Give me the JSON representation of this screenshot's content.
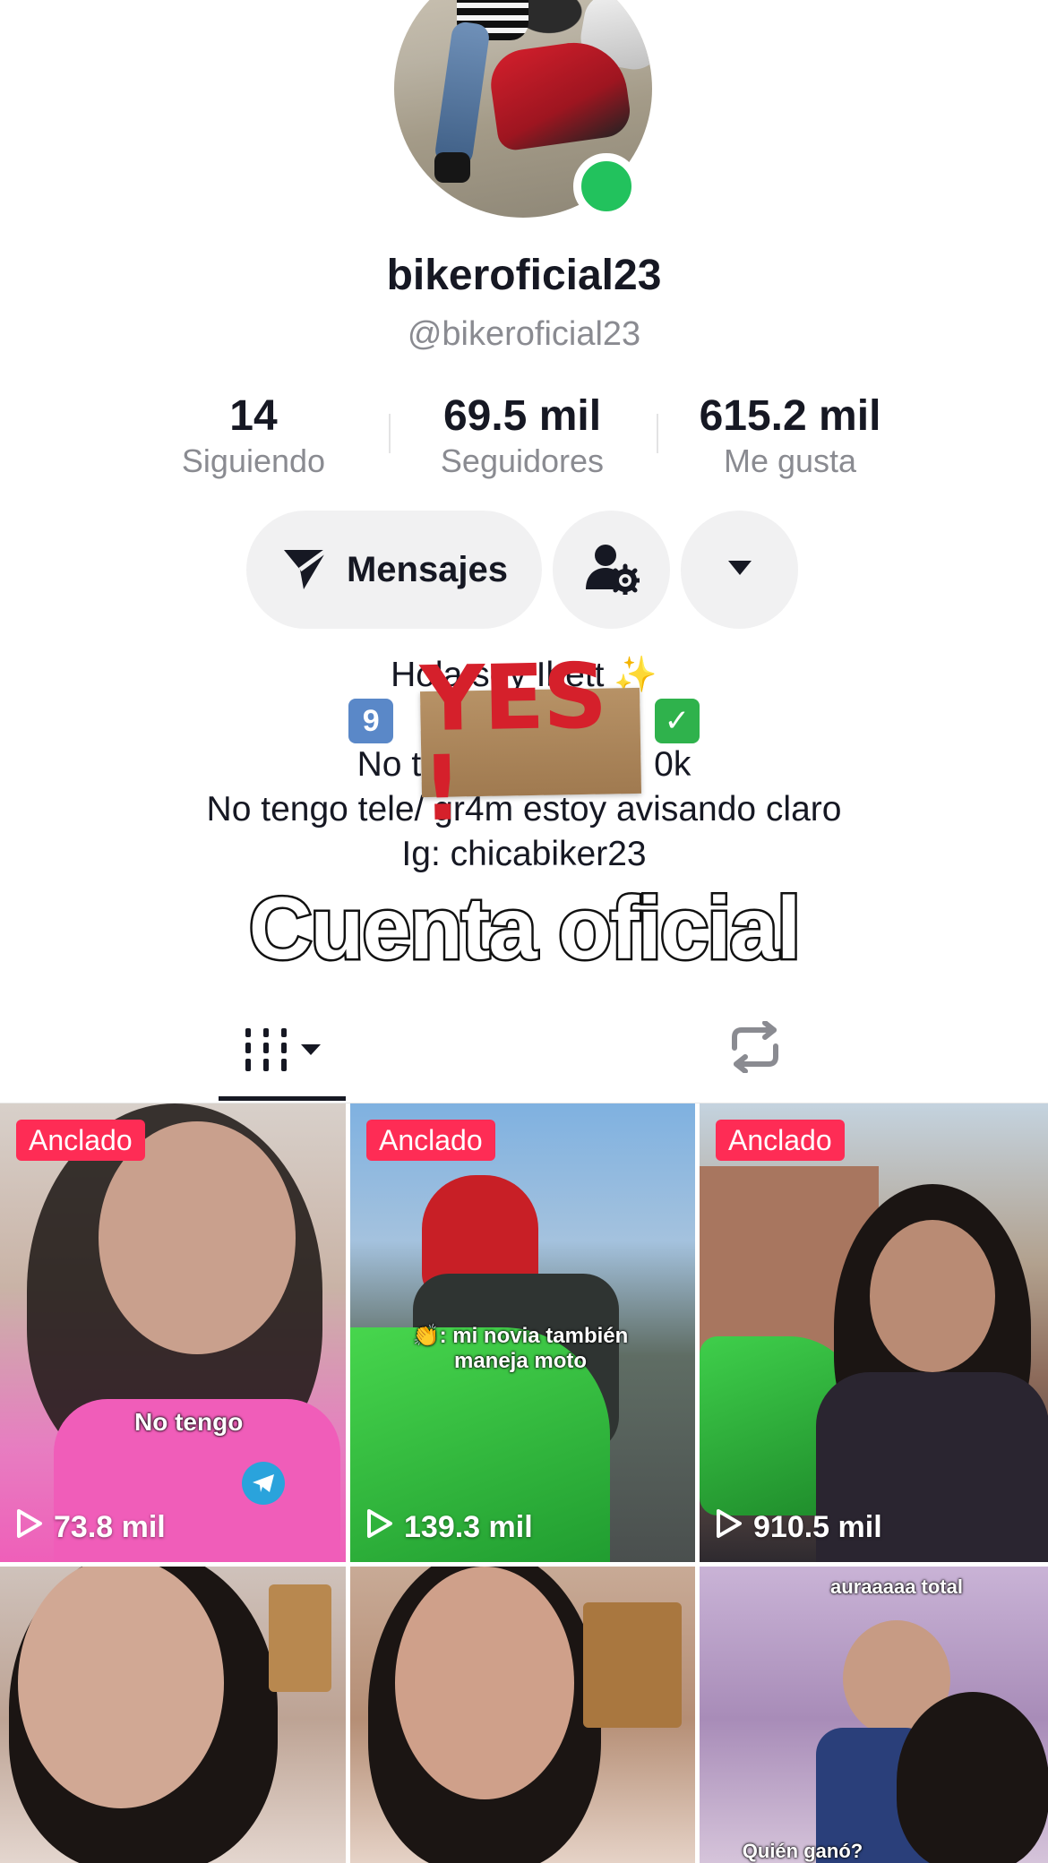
{
  "profile": {
    "display_name": "bikeroficial23",
    "username": "@bikeroficial23"
  },
  "stats": [
    {
      "value": "14",
      "label": "Siguiendo"
    },
    {
      "value": "69.5 mil",
      "label": "Seguidores"
    },
    {
      "value": "615.2 mil",
      "label": "Me gusta"
    }
  ],
  "actions": {
    "message_label": "Mensajes"
  },
  "bio": {
    "line1": "Hola soy Ibett ✨",
    "line2_nine": "9",
    "line2_check": "✓",
    "line3_left": "No t",
    "line3_right": "0k",
    "line4": "No tengo tele/ gr4m estoy avisando claro",
    "line5": "Ig: chicabiker23"
  },
  "sticker": {
    "text": "YES !"
  },
  "overlay": {
    "text": "Cuenta oficial"
  },
  "videos": [
    {
      "pinned": "Anclado",
      "views": "73.8 mil",
      "caption": "No tengo"
    },
    {
      "pinned": "Anclado",
      "views": "139.3 mil",
      "caption": "👏: mi novia también maneja moto"
    },
    {
      "pinned": "Anclado",
      "views": "910.5 mil",
      "caption": ""
    },
    {
      "pinned": "",
      "views": "",
      "caption": ""
    },
    {
      "pinned": "",
      "views": "",
      "caption": ""
    },
    {
      "pinned": "",
      "views": "",
      "caption_top": "auraaaaa total",
      "caption_bottom": "Quién ganó?"
    }
  ],
  "colors": {
    "accent": "#fe2c55",
    "online": "#22c25d",
    "text": "#161823",
    "muted": "#8a8b91"
  }
}
